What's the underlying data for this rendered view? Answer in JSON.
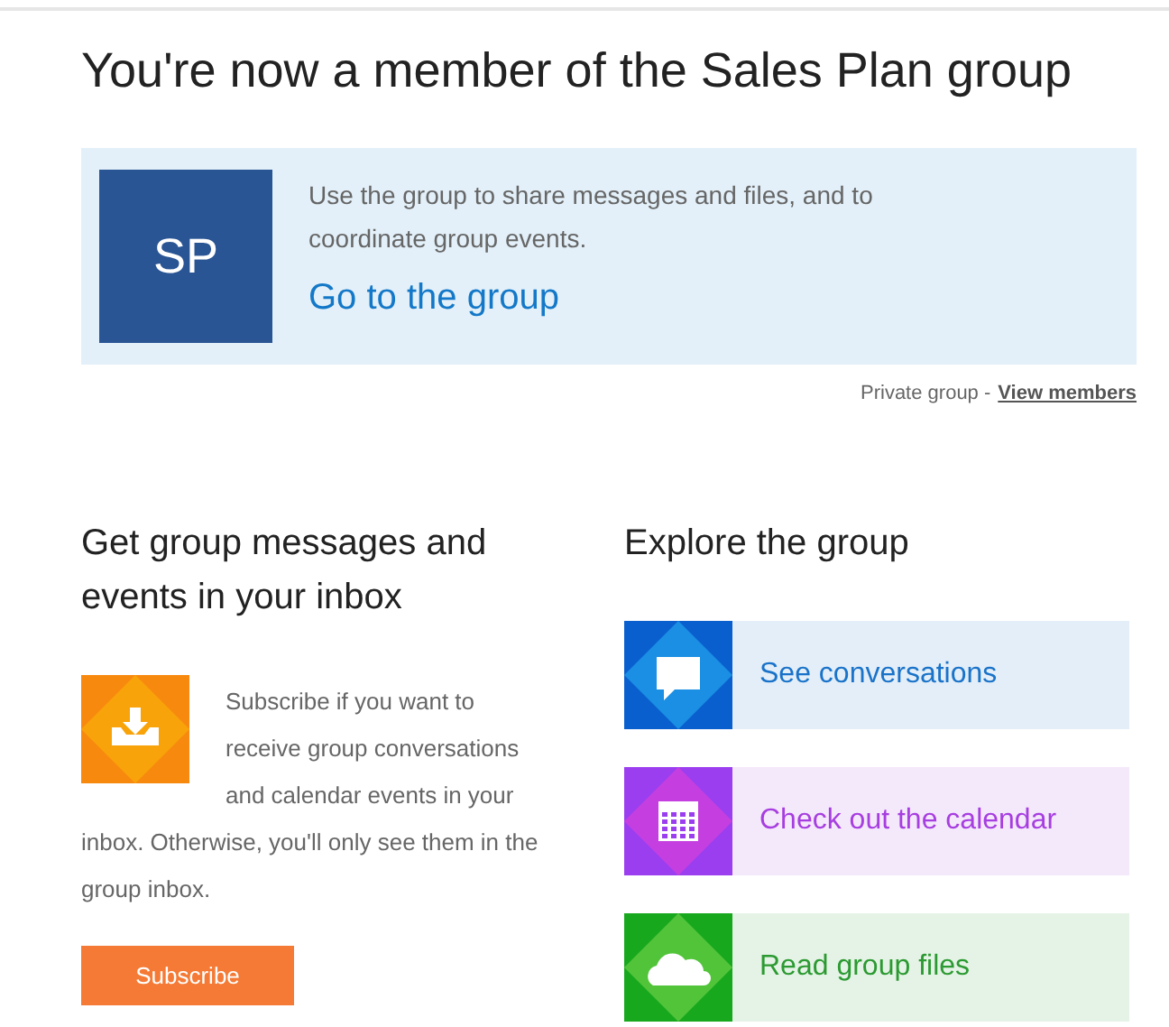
{
  "title": "You're now a member of the Sales Plan group",
  "banner": {
    "initials": "SP",
    "description": "Use the group to share messages and files, and to coordinate group events.",
    "link": "Go to the group"
  },
  "privacy": {
    "label": "Private group -",
    "link": "View members"
  },
  "subscribe": {
    "heading": "Get group messages and events in your inbox",
    "text_beside": "Subscribe if you want to receive group conversations and calendar events in your",
    "text_below": "inbox. Otherwise, you'll only see them in the group inbox.",
    "button": "Subscribe"
  },
  "explore": {
    "heading": "Explore the group",
    "tiles": [
      {
        "kind": "conversations",
        "label": "See conversations",
        "color": "#1a73c9"
      },
      {
        "kind": "calendar",
        "label": "Check out the calendar",
        "color": "#a73ee0"
      },
      {
        "kind": "files",
        "label": "Read group files",
        "color": "#2c9a32"
      }
    ]
  }
}
